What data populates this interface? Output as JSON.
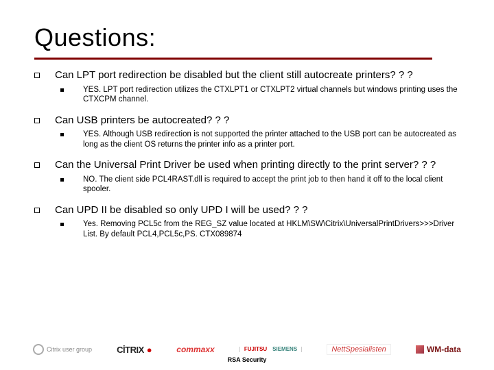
{
  "title": "Questions:",
  "questions": [
    {
      "q": "Can LPT port redirection be disabled but the client still autocreate printers? ? ?",
      "a": "YES. LPT port redirection utilizes the CTXLPT1 or CTXLPT2 virtual channels but windows printing uses the CTXCPM channel."
    },
    {
      "q": "Can USB printers be autocreated? ? ?",
      "a": "YES. Although USB redirection is not supported the printer attached to the USB port can be autocreated as long as the client OS returns the printer info as a printer port."
    },
    {
      "q": "Can the Universal Print Driver be used when printing directly to the print server? ? ?",
      "a": "NO. The client side PCL4RAST.dll is required to accept the print job to then hand it off to the local client spooler."
    },
    {
      "q": "Can UPD II be disabled so only UPD I will be used? ? ?",
      "a": "Yes. Removing PCL5c from the REG_SZ value located at HKLM\\SW\\Citrix\\UniversalPrintDrivers>>>Driver List. By default PCL4,PCL5c,PS. CTX089874"
    }
  ],
  "footer": {
    "logos": {
      "cug": "Citrix user group",
      "citrix": "CİTRIX",
      "commaxx": "commaxx",
      "fujitsu_top": "FUJITSU",
      "fujitsu_bot": "SIEMENS",
      "nett": "NettSpesialisten",
      "wm": "WM-data"
    },
    "security": "RSA Security"
  }
}
